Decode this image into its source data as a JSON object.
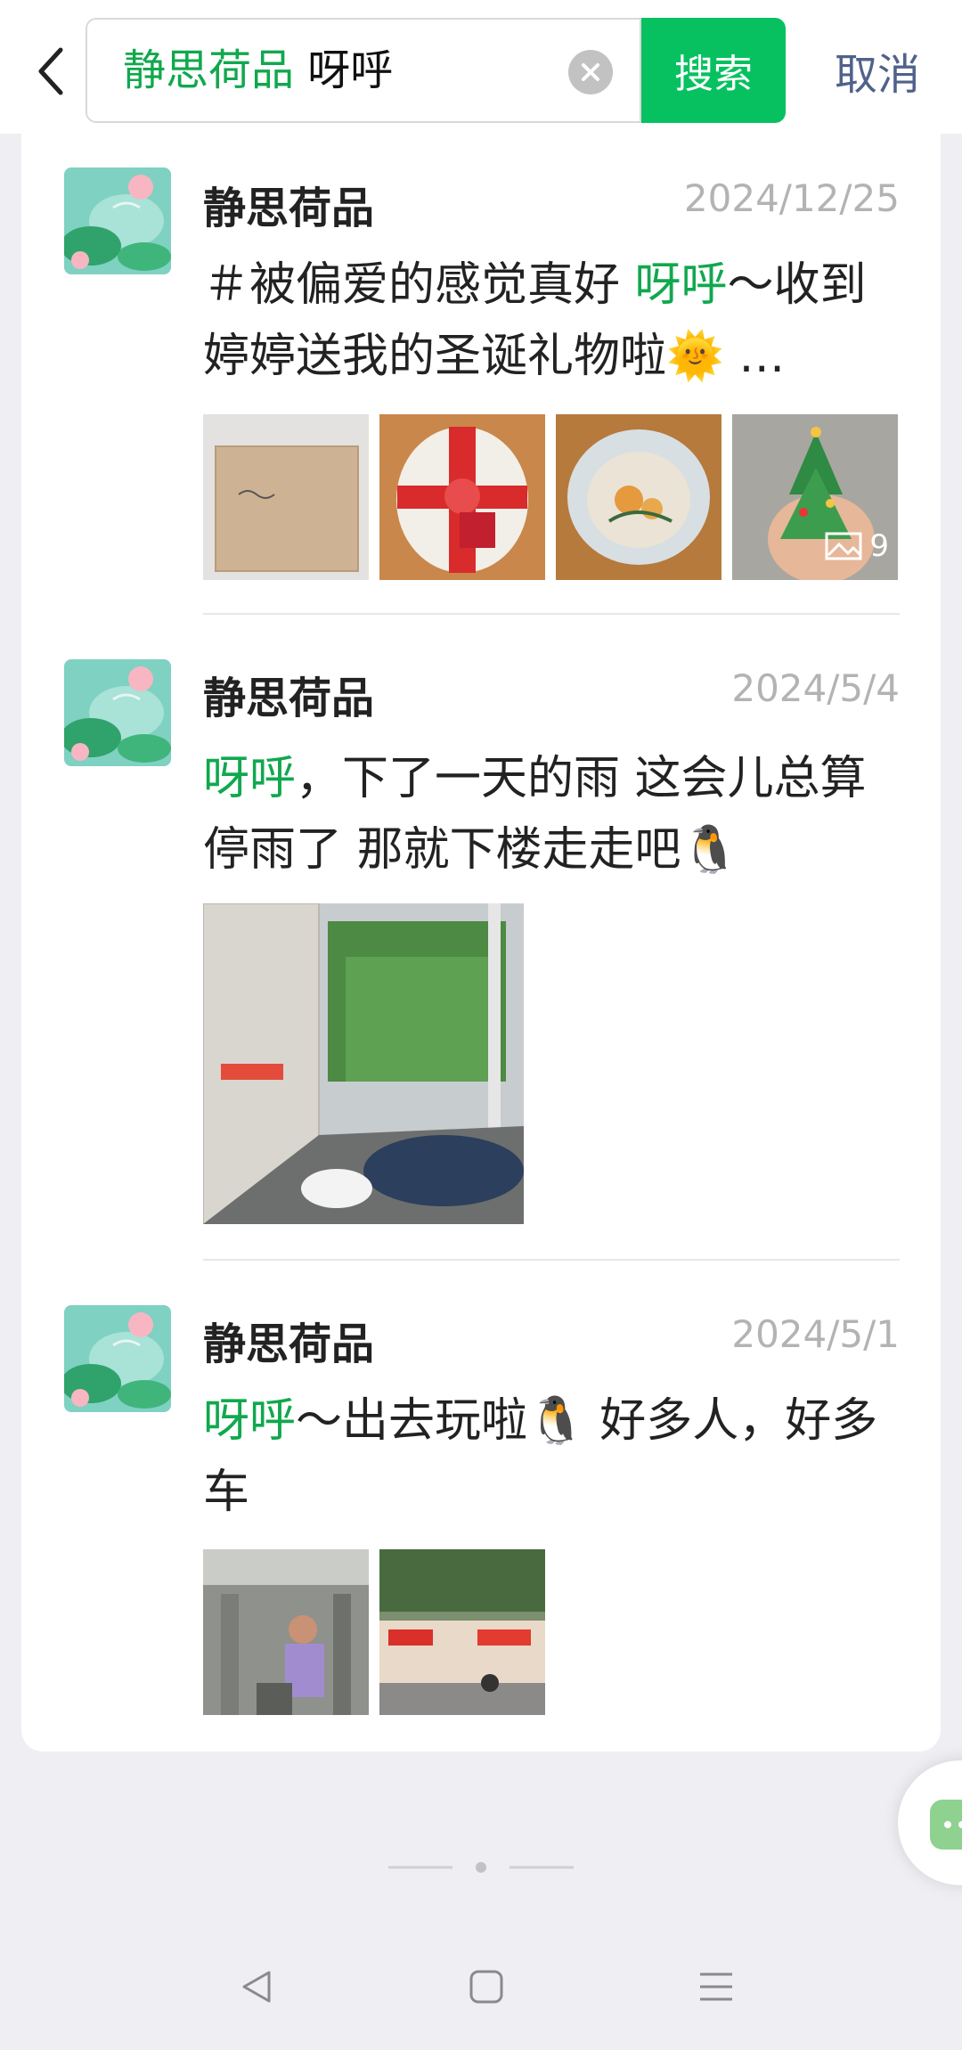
{
  "search": {
    "query_highlight": "静思荷品",
    "query_rest": " 呀呼",
    "search_label": "搜索",
    "cancel_label": "取消"
  },
  "posts": [
    {
      "author": "静思荷品",
      "date": "2024/12/25",
      "text_before": "＃被偏爱的感觉真好 ",
      "text_highlight": "呀呼",
      "text_after": "～收到婷婷送我的圣诞礼物啦🌞 …",
      "image_count_badge": "9"
    },
    {
      "author": "静思荷品",
      "date": "2024/5/4",
      "text_highlight": "呀呼",
      "text_after": "，下了一天的雨 这会儿总算停雨了 那就下楼走走吧🐧"
    },
    {
      "author": "静思荷品",
      "date": "2024/5/1",
      "text_highlight": "呀呼",
      "text_after": "～出去玩啦🐧 好多人，好多车"
    }
  ],
  "colors": {
    "accent": "#07c160",
    "highlight_text": "#11a84e",
    "cancel_text": "#50628a",
    "background": "#efeff3"
  },
  "icons": {
    "back": "chevron-left-icon",
    "clear": "clear-icon",
    "gallery": "image-gallery-icon",
    "nav_back": "nav-back-icon",
    "nav_home": "nav-home-icon",
    "nav_menu": "nav-menu-icon"
  }
}
